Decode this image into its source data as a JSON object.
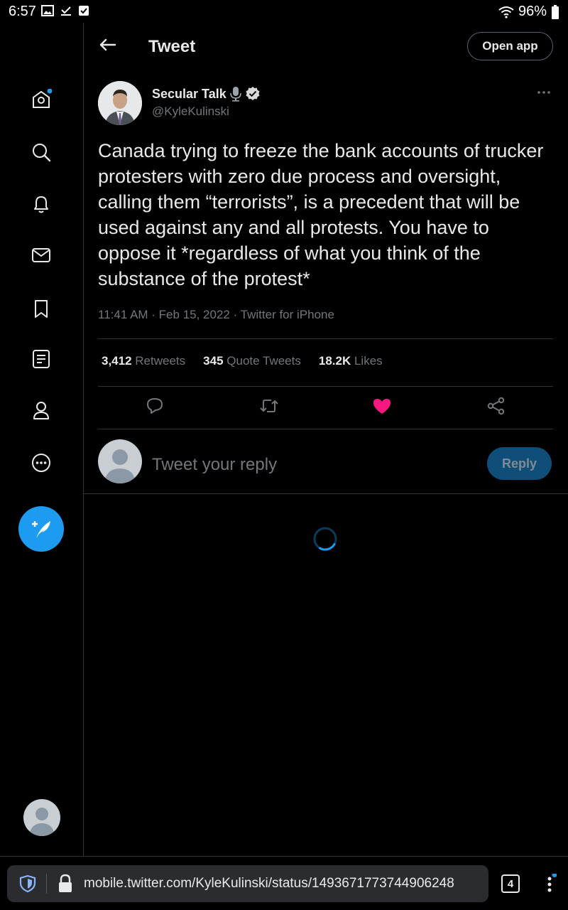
{
  "status_bar": {
    "time": "6:57",
    "battery": "96%"
  },
  "header": {
    "title": "Tweet",
    "open_app_label": "Open app"
  },
  "tweet": {
    "author_name": "Secular Talk",
    "author_handle": "@KyleKulinski",
    "text": "Canada trying to freeze the bank accounts of trucker protesters with zero due process and oversight, calling them “terrorists”, is a precedent that will be used against any and all protests. You have to oppose it *regardless of what you think of the substance of the protest*",
    "meta": "11:41 AM · Feb 15, 2022 · Twitter for iPhone",
    "stats": {
      "retweets_count": "3,412",
      "retweets_label": "Retweets",
      "quotes_count": "345",
      "quotes_label": "Quote Tweets",
      "likes_count": "18.2K",
      "likes_label": "Likes"
    },
    "liked": true
  },
  "reply": {
    "placeholder": "Tweet your reply",
    "button_label": "Reply"
  },
  "browser": {
    "url": "mobile.twitter.com/KyleKulinski/status/1493671773744906248",
    "tab_count": "4"
  },
  "colors": {
    "accent": "#1d9bf0",
    "like": "#f91880",
    "background": "#000000",
    "muted_text": "#71767b"
  },
  "nav_icons": [
    "home-icon",
    "search-icon",
    "notifications-icon",
    "messages-icon",
    "bookmarks-icon",
    "lists-icon",
    "profile-icon",
    "more-icon"
  ]
}
